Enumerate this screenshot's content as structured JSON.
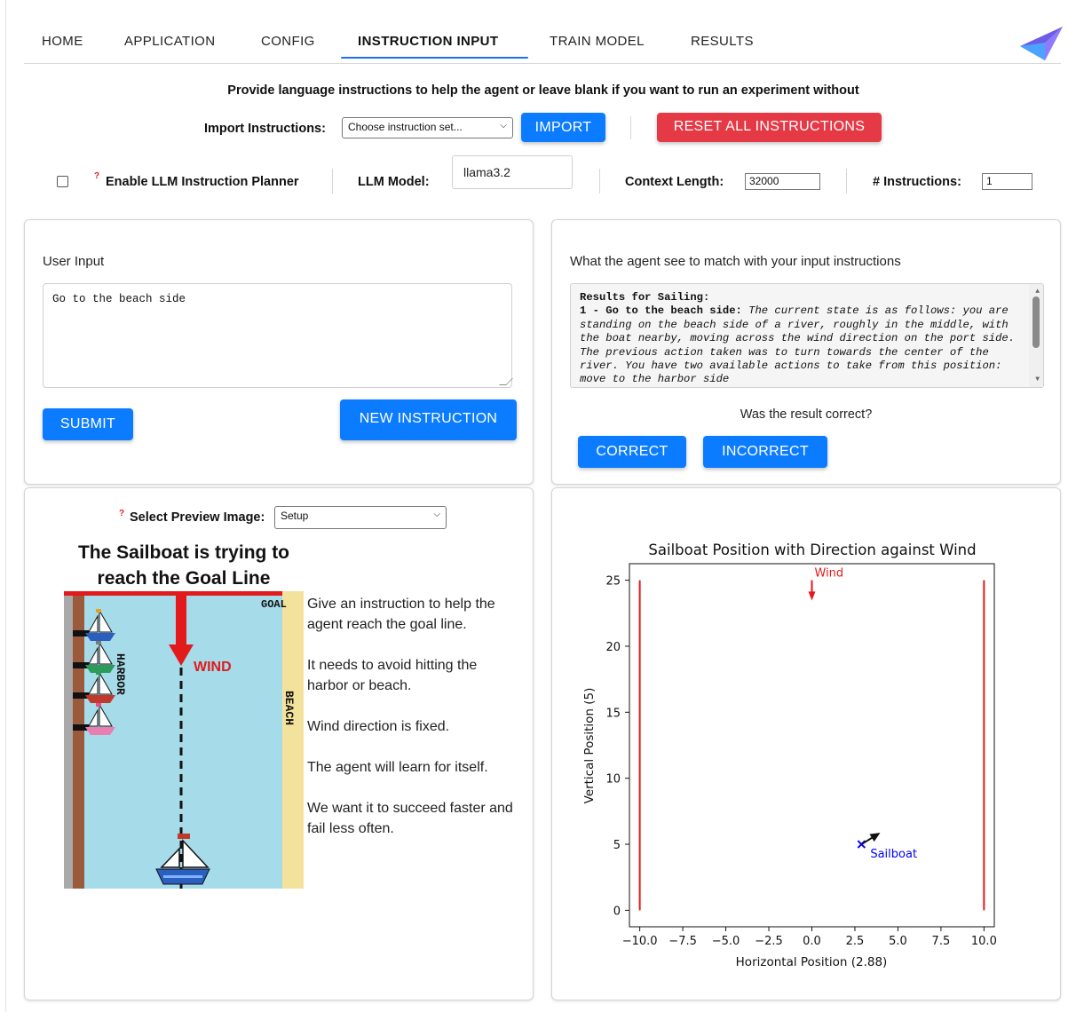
{
  "nav": {
    "tabs": [
      {
        "label": "HOME"
      },
      {
        "label": "APPLICATION"
      },
      {
        "label": "CONFIG"
      },
      {
        "label": "INSTRUCTION INPUT"
      },
      {
        "label": "TRAIN MODEL"
      },
      {
        "label": "RESULTS"
      }
    ],
    "active_tab": "INSTRUCTION INPUT",
    "logo_icon": "triangle-logo-icon"
  },
  "intro": "Provide language instructions to help the agent or leave blank if you want to run an experiment without",
  "import": {
    "label": "Import Instructions:",
    "select_value": "Choose instruction set...",
    "import_button": "IMPORT",
    "reset_button": "RESET ALL INSTRUCTIONS"
  },
  "settings": {
    "llm_planner_label": "Enable LLM Instruction Planner",
    "llm_planner_checked": false,
    "help_mark": "?",
    "llm_model_label": "LLM Model:",
    "llm_model_value": "llama3.2",
    "context_length_label": "Context Length:",
    "context_length_value": "32000",
    "num_instructions_label": "# Instructions:",
    "num_instructions_value": "1"
  },
  "user_input": {
    "title": "User Input",
    "text": "Go to the beach side",
    "submit_button": "SUBMIT",
    "new_instruction_button": "NEW INSTRUCTION"
  },
  "agent_view": {
    "title": "What the agent see to match with your input instructions",
    "results_heading": "Results for Sailing:",
    "result_item_label": "1 - Go to the beach side:",
    "result_item_text": "The current state is as follows: you are standing on the beach side of a river, roughly in the middle, with the boat nearby, moving across the wind direction on the port side. The previous action taken was to turn towards the center of the river. You have two available actions to take from this position: move to the harbor side",
    "question": "Was the result correct?",
    "correct_button": "CORRECT",
    "incorrect_button": "INCORRECT"
  },
  "preview": {
    "select_label": "Select Preview Image:",
    "select_value": "Setup",
    "image_title_line1": "The Sailboat is trying to",
    "image_title_line2": "reach the Goal Line",
    "goal_label": "GOAL",
    "wind_label": "WIND",
    "harbor_label": "HARBOR",
    "beach_label": "BEACH",
    "paragraphs": [
      "Give an instruction to help the agent reach the goal line.",
      "It needs to avoid hitting the harbor or beach.",
      "Wind direction is fixed.",
      "The agent will learn for itself.",
      "We want it to succeed faster and fail less often."
    ]
  },
  "chart_data": {
    "type": "scatter",
    "title": "Sailboat Position with Direction against Wind",
    "xlabel": "Horizontal Position (2.88)",
    "ylabel": "Vertical Position (5)",
    "xlim": [
      -10.6,
      10.6
    ],
    "ylim": [
      -1.25,
      26.25
    ],
    "xticks": [
      -10.0,
      -7.5,
      -5.0,
      -2.5,
      0.0,
      2.5,
      5.0,
      7.5,
      10.0
    ],
    "xtick_labels": [
      "−10.0",
      "−7.5",
      "−5.0",
      "−2.5",
      "0.0",
      "2.5",
      "5.0",
      "7.5",
      "10.0"
    ],
    "yticks": [
      0,
      5,
      10,
      15,
      20,
      25
    ],
    "ytick_labels": [
      "0",
      "5",
      "10",
      "15",
      "20",
      "25"
    ],
    "boundary_lines": [
      {
        "x": -10,
        "y_from": 0,
        "y_to": 25,
        "color": "#e31a1c"
      },
      {
        "x": 10,
        "y_from": 0,
        "y_to": 25,
        "color": "#e31a1c"
      }
    ],
    "wind": {
      "x": 0,
      "y": 25,
      "dy": -1.4,
      "label": "Wind",
      "color": "#e31a1c"
    },
    "sailboat": {
      "x": 2.88,
      "y": 5,
      "label": "Sailboat",
      "marker": "x",
      "color": "#0000ff",
      "heading_dx": 1.0,
      "heading_dy": 0.8
    },
    "grid": false
  }
}
